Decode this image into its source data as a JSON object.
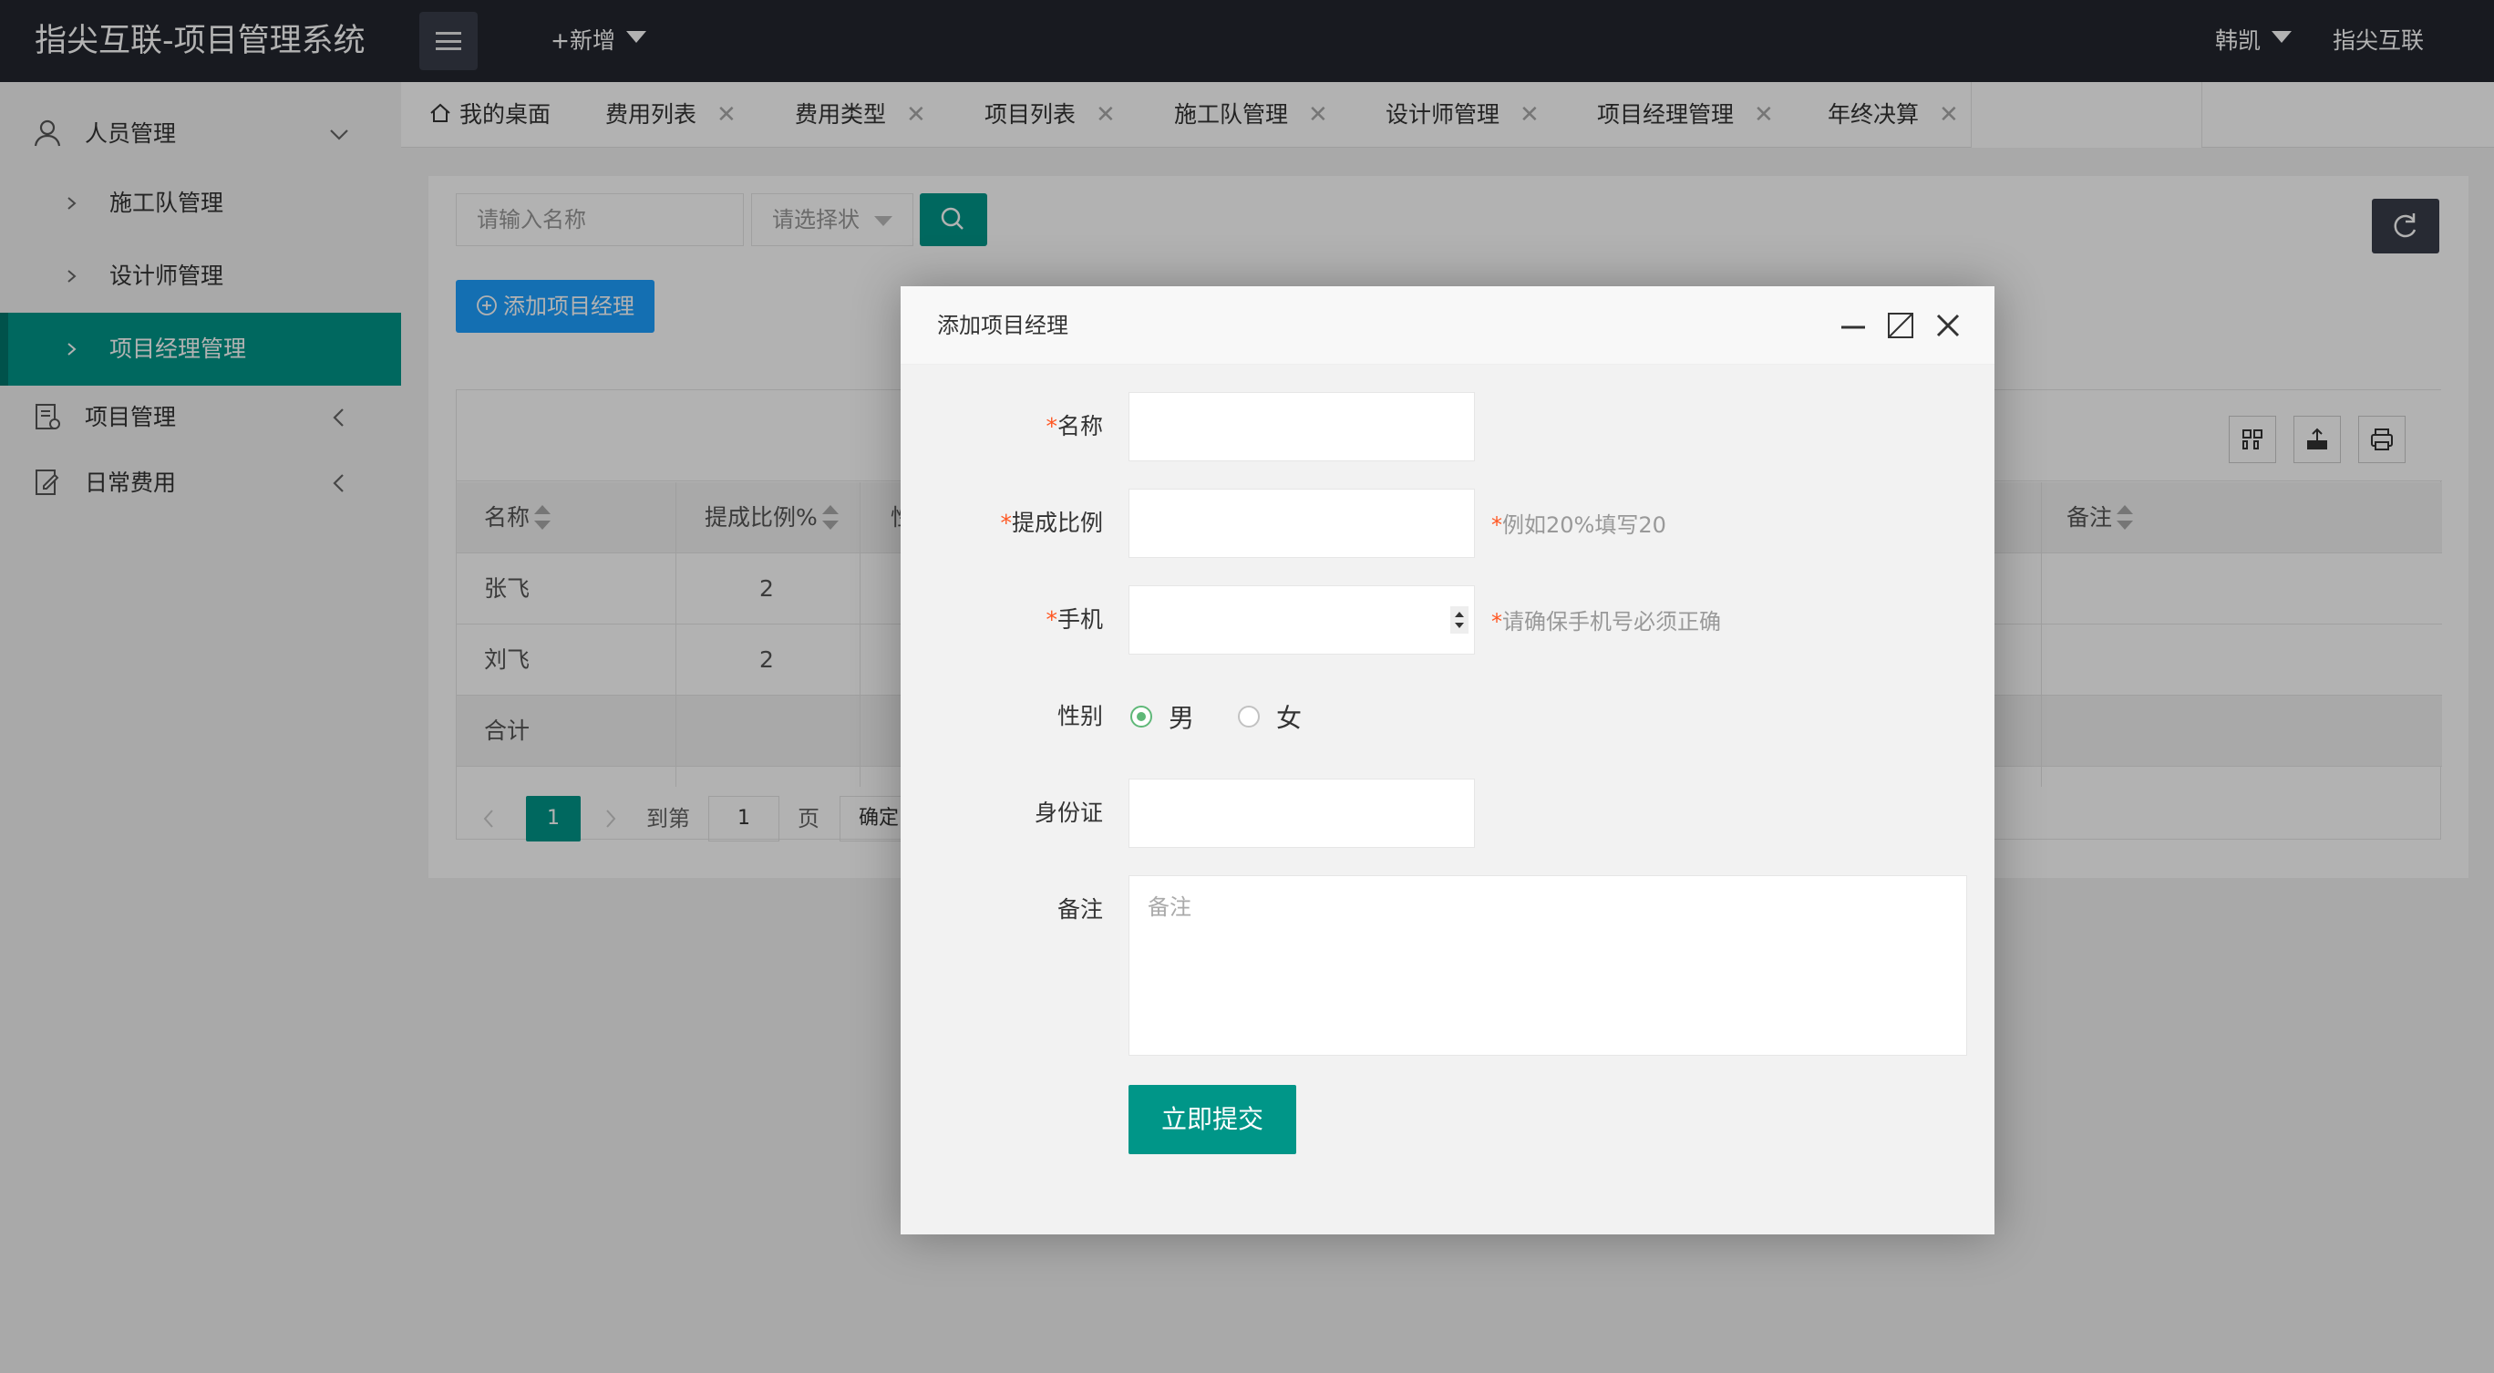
{
  "app": {
    "title": "指尖互联-项目管理系统"
  },
  "header": {
    "new_label": "+新增",
    "user_name": "韩凯",
    "brand_link": "指尖互联"
  },
  "sidebar": {
    "groups": [
      {
        "label": "人员管理",
        "icon": "user-icon",
        "expanded": true
      },
      {
        "label": "项目管理",
        "icon": "document-icon"
      },
      {
        "label": "日常费用",
        "icon": "edit-document-icon"
      }
    ],
    "sub_items": [
      {
        "label": "施工队管理"
      },
      {
        "label": "设计师管理"
      },
      {
        "label": "项目经理管理",
        "active": true
      }
    ]
  },
  "tabs": [
    {
      "label": "我的桌面",
      "icon": "home-icon",
      "closable": false
    },
    {
      "label": "费用列表",
      "closable": true
    },
    {
      "label": "费用类型",
      "closable": true
    },
    {
      "label": "项目列表",
      "closable": true
    },
    {
      "label": "施工队管理",
      "closable": true
    },
    {
      "label": "设计师管理",
      "closable": true
    },
    {
      "label": "项目经理管理",
      "closable": true,
      "active": true
    },
    {
      "label": "年终决算",
      "closable": true
    }
  ],
  "search": {
    "name_placeholder": "请输入名称",
    "select_placeholder": "请选择状"
  },
  "toolbar": {
    "add_label": "添加项目经理"
  },
  "table": {
    "columns": [
      "名称",
      "提成比例%",
      "性",
      "备注"
    ],
    "rows": [
      {
        "name": "张飞",
        "ratio": "2"
      },
      {
        "name": "刘飞",
        "ratio": "2"
      }
    ],
    "total_label": "合计"
  },
  "pager": {
    "current_page": "1",
    "goto_label": "到第",
    "goto_value": "1",
    "page_unit": "页",
    "confirm_label": "确定"
  },
  "modal": {
    "title": "添加项目经理",
    "fields": {
      "name_label": "名称",
      "ratio_label": "提成比例",
      "ratio_hint": "例如20%填写20",
      "phone_label": "手机",
      "phone_hint": "请确保手机号必须正确",
      "gender_label": "性别",
      "gender_male": "男",
      "gender_female": "女",
      "id_label": "身份证",
      "remark_label": "备注",
      "remark_placeholder": "备注"
    },
    "required_mark": "*",
    "submit_label": "立即提交"
  },
  "colors": {
    "primary": "#009688",
    "blue": "#1e9fff",
    "topbar": "#23262e",
    "required": "#ff5722"
  }
}
